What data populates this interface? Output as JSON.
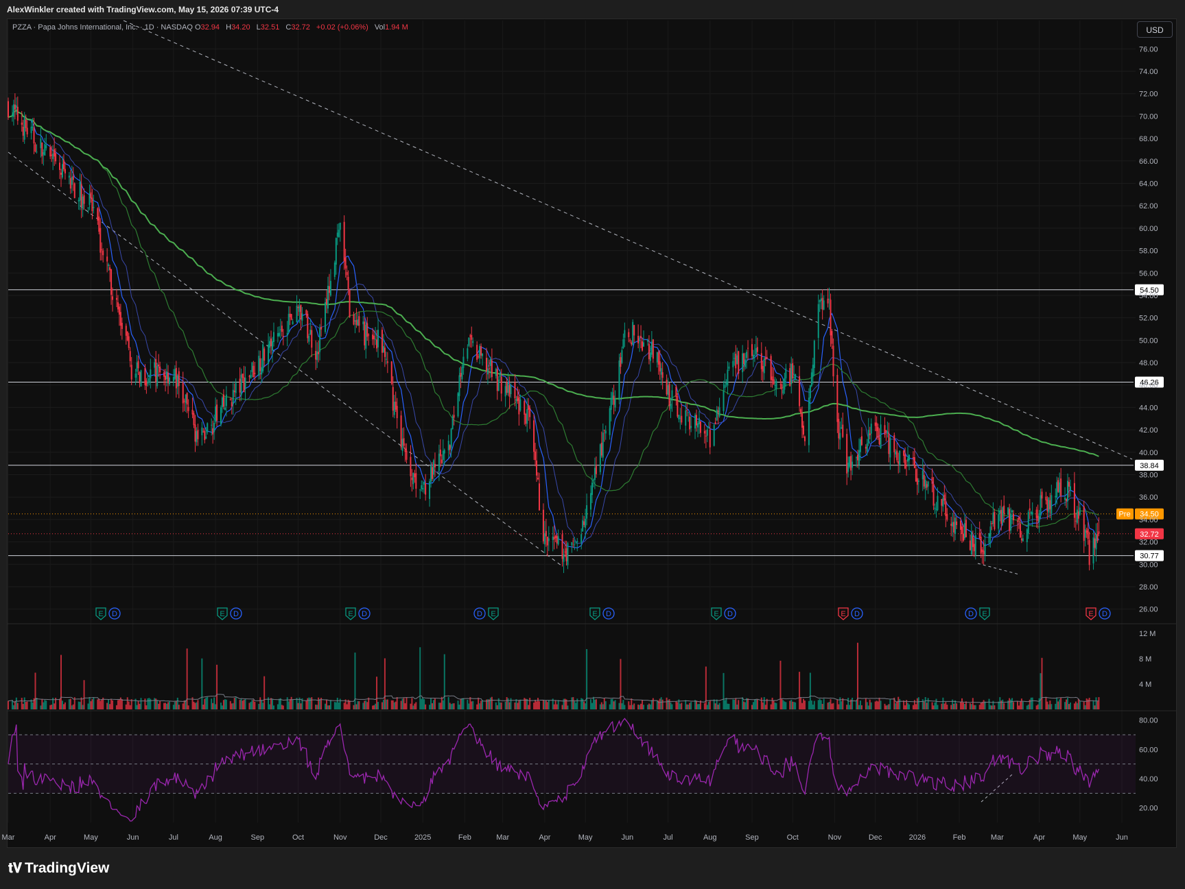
{
  "header": {
    "attribution": "AlexWinkler created with TradingView.com, May 15, 2026 07:39 UTC-4"
  },
  "legend": {
    "symbol": "PZZA · Papa Johns International, Inc. · 1D · NASDAQ",
    "open_label": "O",
    "open": "32.94",
    "high_label": "H",
    "high": "34.20",
    "low_label": "L",
    "low": "32.51",
    "close_label": "C",
    "close": "32.72",
    "change": "+0.02 (+0.06%)",
    "vol_label": "Vol",
    "vol": "1.94 M"
  },
  "currency": "USD",
  "price_axis": {
    "ticks": [
      "76.00",
      "74.00",
      "72.00",
      "70.00",
      "68.00",
      "66.00",
      "64.00",
      "62.00",
      "60.00",
      "58.00",
      "56.00",
      "54.00",
      "52.00",
      "50.00",
      "48.00",
      "46.00",
      "44.00",
      "42.00",
      "40.00",
      "38.00",
      "36.00",
      "34.00",
      "32.00",
      "30.00",
      "28.00",
      "26.00"
    ]
  },
  "price_levels": [
    {
      "label": "54.50",
      "value": 54.5
    },
    {
      "label": "46.26",
      "value": 46.26
    },
    {
      "label": "38.84",
      "value": 38.84
    },
    {
      "label": "30.77",
      "value": 30.77
    }
  ],
  "premarket": {
    "tag": "Pre",
    "label": "34.50",
    "value": 34.5,
    "color": "#ff9800"
  },
  "last_price": {
    "label": "32.72",
    "value": 32.72,
    "color": "#f23645"
  },
  "volume_axis": {
    "ticks": [
      "12 M",
      "8 M",
      "4 M"
    ]
  },
  "rsi_axis": {
    "ticks": [
      "80.00",
      "60.00",
      "40.00",
      "20.00"
    ]
  },
  "time_axis": {
    "labels": [
      "Mar",
      "Apr",
      "May",
      "Jun",
      "Jul",
      "Aug",
      "Sep",
      "Oct",
      "Nov",
      "Dec",
      "2025",
      "Feb",
      "Mar",
      "Apr",
      "May",
      "Jun",
      "Jul",
      "Aug",
      "Sep",
      "Oct",
      "Nov",
      "Dec",
      "2026",
      "Feb",
      "Mar",
      "Apr",
      "May",
      "Jun"
    ]
  },
  "events": [
    {
      "letters": [
        "E",
        "D"
      ],
      "earnings_color": "#089981"
    },
    {
      "letters": [
        "E",
        "D"
      ],
      "earnings_color": "#089981"
    },
    {
      "letters": [
        "E",
        "D"
      ],
      "earnings_color": "#089981"
    },
    {
      "letters": [
        "D",
        "E"
      ],
      "earnings_color": "#089981"
    },
    {
      "letters": [
        "E",
        "D"
      ],
      "earnings_color": "#089981"
    },
    {
      "letters": [
        "E",
        "D"
      ],
      "earnings_color": "#089981"
    },
    {
      "letters": [
        "E",
        "D"
      ],
      "earnings_color": "#f23645"
    },
    {
      "letters": [
        "D",
        "E"
      ],
      "earnings_color": "#089981"
    },
    {
      "letters": [
        "E",
        "D"
      ],
      "earnings_color": "#f23645"
    }
  ],
  "colors": {
    "up": "#089981",
    "down": "#f23645",
    "ma_fast": "#2962ff",
    "ma_mid": "#2e7d32",
    "ma_slow": "#4caf50",
    "rsi": "#9c27b0",
    "background": "#0f0f0f"
  },
  "footer": {
    "brand": "TradingView"
  },
  "chart_data": {
    "type": "candlestick",
    "anchors": [
      {
        "date": "2024-03",
        "price": 71
      },
      {
        "date": "2024-04",
        "price": 66
      },
      {
        "date": "2024-05",
        "price": 62
      },
      {
        "date": "2024-05-20",
        "price": 53
      },
      {
        "date": "2024-06",
        "price": 47
      },
      {
        "date": "2024-07",
        "price": 47
      },
      {
        "date": "2024-07-20",
        "price": 41
      },
      {
        "date": "2024-08",
        "price": 43
      },
      {
        "date": "2024-09",
        "price": 48
      },
      {
        "date": "2024-10",
        "price": 53
      },
      {
        "date": "2024-10-15",
        "price": 49
      },
      {
        "date": "2024-11",
        "price": 60
      },
      {
        "date": "2024-11-10",
        "price": 51
      },
      {
        "date": "2024-12",
        "price": 50
      },
      {
        "date": "2024-12-20",
        "price": 39
      },
      {
        "date": "2025-01",
        "price": 37
      },
      {
        "date": "2025-01-20",
        "price": 40
      },
      {
        "date": "2025-02",
        "price": 50
      },
      {
        "date": "2025-03",
        "price": 46
      },
      {
        "date": "2025-03-20",
        "price": 43
      },
      {
        "date": "2025-04",
        "price": 32
      },
      {
        "date": "2025-04-20",
        "price": 31
      },
      {
        "date": "2025-05",
        "price": 34
      },
      {
        "date": "2025-05-20",
        "price": 44
      },
      {
        "date": "2025-06",
        "price": 51
      },
      {
        "date": "2025-06-20",
        "price": 49
      },
      {
        "date": "2025-07",
        "price": 45
      },
      {
        "date": "2025-08",
        "price": 41
      },
      {
        "date": "2025-08-15",
        "price": 47
      },
      {
        "date": "2025-09",
        "price": 49
      },
      {
        "date": "2025-09-20",
        "price": 46
      },
      {
        "date": "2025-10",
        "price": 47
      },
      {
        "date": "2025-10-10",
        "price": 42
      },
      {
        "date": "2025-10-20",
        "price": 53
      },
      {
        "date": "2025-10-28",
        "price": 54
      },
      {
        "date": "2025-11",
        "price": 44
      },
      {
        "date": "2025-11-10",
        "price": 39
      },
      {
        "date": "2025-12",
        "price": 42
      },
      {
        "date": "2026-01",
        "price": 38
      },
      {
        "date": "2026-02",
        "price": 33
      },
      {
        "date": "2026-02-20",
        "price": 31
      },
      {
        "date": "2026-03",
        "price": 35
      },
      {
        "date": "2026-03-20",
        "price": 33
      },
      {
        "date": "2026-04",
        "price": 35
      },
      {
        "date": "2026-04-20",
        "price": 37
      },
      {
        "date": "2026-05",
        "price": 34
      },
      {
        "date": "2026-05-08",
        "price": 31
      },
      {
        "date": "2026-05-15",
        "price": 32.72
      }
    ],
    "price_range": [
      25,
      77
    ],
    "volume_range_millions": [
      0,
      13
    ],
    "rsi_range": [
      10,
      85
    ],
    "rsi_bands": [
      30,
      50,
      70
    ]
  }
}
